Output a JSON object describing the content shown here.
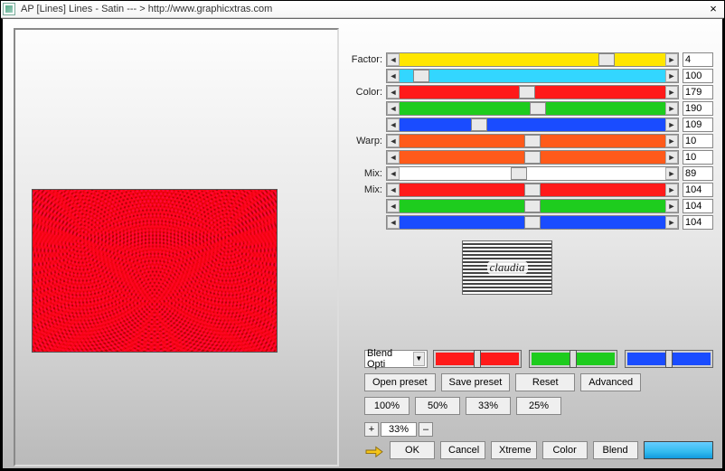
{
  "window": {
    "title": "AP [Lines]  Lines - Satin    --- >  http://www.graphicxtras.com",
    "close_icon": "×"
  },
  "sliders": [
    {
      "label": "Factor:",
      "color": "#ffe600",
      "thumb_pct": 78,
      "value": "4"
    },
    {
      "label": "",
      "color": "#33d6ff",
      "thumb_pct": 8,
      "value": "100"
    },
    {
      "label": "Color:",
      "color": "#ff1a1a",
      "thumb_pct": 48,
      "value": "179"
    },
    {
      "label": "",
      "color": "#1ecc1e",
      "thumb_pct": 52,
      "value": "190"
    },
    {
      "label": "",
      "color": "#1a4cff",
      "thumb_pct": 30,
      "value": "109"
    },
    {
      "label": "Warp:",
      "color": "#ff5a1a",
      "thumb_pct": 50,
      "value": "10"
    },
    {
      "label": "",
      "color": "#ff5a1a",
      "thumb_pct": 50,
      "value": "10"
    },
    {
      "label": "Mix:",
      "color": "#ffffff",
      "thumb_pct": 45,
      "value": "89"
    },
    {
      "label": "Mix:",
      "color": "#ff1a1a",
      "thumb_pct": 50,
      "value": "104"
    },
    {
      "label": "",
      "color": "#1ecc1e",
      "thumb_pct": 50,
      "value": "104"
    },
    {
      "label": "",
      "color": "#1a4cff",
      "thumb_pct": 50,
      "value": "104"
    }
  ],
  "logo_text": "claudia",
  "blend_select": {
    "label": "Blend Opti",
    "dd": "▼"
  },
  "rgb_minis": [
    {
      "bg": "#ff1a1a"
    },
    {
      "bg": "#1ecc1e"
    },
    {
      "bg": "#1a4cff"
    }
  ],
  "buttons": {
    "open_preset": "Open preset",
    "save_preset": "Save preset",
    "reset": "Reset",
    "advanced": "Advanced",
    "p100": "100%",
    "p50": "50%",
    "p33": "33%",
    "p25": "25%",
    "ok": "OK",
    "cancel": "Cancel",
    "xtreme": "Xtreme",
    "color": "Color",
    "blend": "Blend"
  },
  "zoom": {
    "plus": "+",
    "value": "33%",
    "minus": "–"
  },
  "arrows": {
    "left": "◄",
    "right": "►"
  }
}
